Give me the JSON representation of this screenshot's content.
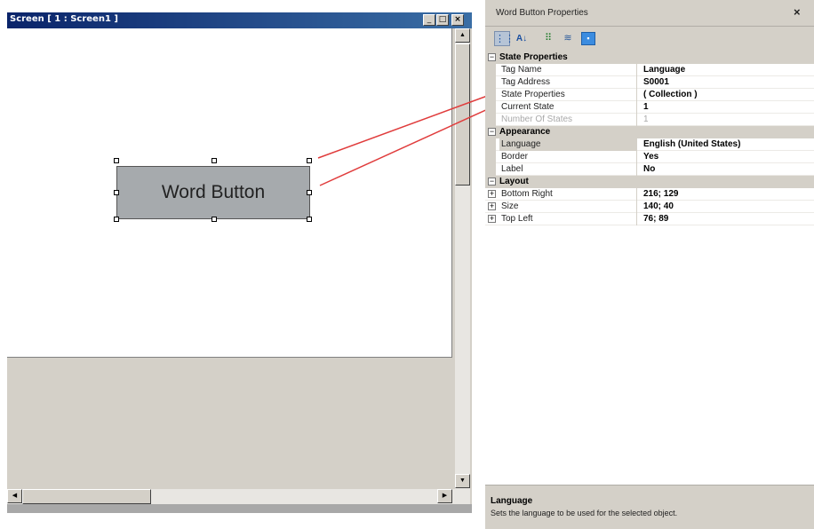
{
  "screen_window": {
    "title": "Screen [ 1 : Screen1 ]",
    "controls": {
      "minimize": "_",
      "maximize": "□",
      "close": "×"
    },
    "word_button_label": "Word Button"
  },
  "properties_panel": {
    "title": "Word Button Properties",
    "close_label": "×",
    "toolbar": {
      "categorized": "⋮⋮",
      "alphabetical": "A↓",
      "properties": "⠿",
      "events": "≋",
      "property_pages": "▪"
    },
    "categories": [
      {
        "label": "State Properties",
        "toggle": "−",
        "properties": [
          {
            "name": "Tag Name",
            "value": "Language"
          },
          {
            "name": "Tag Address",
            "value": "S0001"
          },
          {
            "name": "State Properties",
            "value": "( Collection )"
          },
          {
            "name": "Current State",
            "value": "1"
          },
          {
            "name": "Number Of States",
            "value": "1"
          }
        ]
      },
      {
        "label": "Appearance",
        "toggle": "−",
        "properties": [
          {
            "name": "Language",
            "value": "English (United States)"
          },
          {
            "name": "Border",
            "value": "Yes"
          },
          {
            "name": "Label",
            "value": "No"
          }
        ]
      },
      {
        "label": "Layout",
        "toggle": "−",
        "properties": [
          {
            "name": "Bottom Right",
            "value": "216; 129",
            "expander": "+"
          },
          {
            "name": "Size",
            "value": "140; 40",
            "expander": "+"
          },
          {
            "name": "Top Left",
            "value": "76; 89",
            "expander": "+"
          }
        ]
      }
    ],
    "description": {
      "title": "Language",
      "text": "Sets the language to be used for the selected object."
    }
  },
  "colors": {
    "title_bar": "#0a246a",
    "connector_lines": "#e03c3c",
    "button_face": "#a6aaad"
  }
}
